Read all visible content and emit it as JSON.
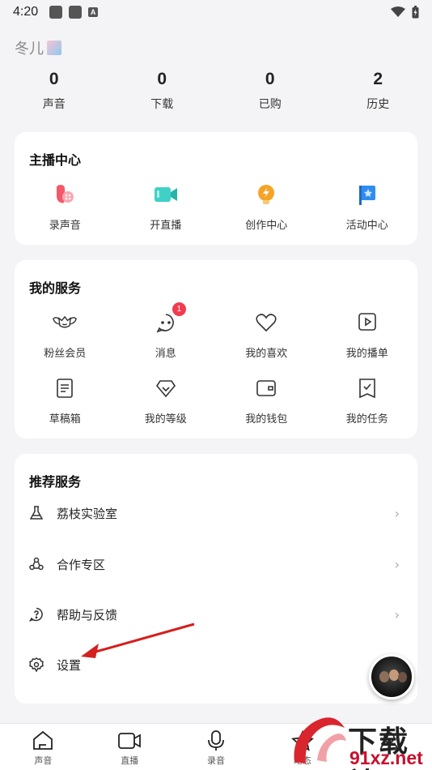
{
  "status": {
    "time": "4:20"
  },
  "profile": {
    "name": "冬儿"
  },
  "stats": [
    {
      "value": "0",
      "label": "声音"
    },
    {
      "value": "0",
      "label": "下载"
    },
    {
      "value": "0",
      "label": "已购"
    },
    {
      "value": "2",
      "label": "历史"
    }
  ],
  "anchor": {
    "title": "主播中心",
    "items": [
      {
        "label": "录声音",
        "icon": "record-voice-icon"
      },
      {
        "label": "开直播",
        "icon": "live-camera-icon"
      },
      {
        "label": "创作中心",
        "icon": "bulb-icon"
      },
      {
        "label": "活动中心",
        "icon": "flag-icon"
      }
    ]
  },
  "services": {
    "title": "我的服务",
    "items": [
      {
        "label": "粉丝会员",
        "icon": "crown-wings-icon"
      },
      {
        "label": "消息",
        "icon": "message-icon",
        "badge": "1"
      },
      {
        "label": "我的喜欢",
        "icon": "heart-icon"
      },
      {
        "label": "我的播单",
        "icon": "playlist-icon"
      },
      {
        "label": "草稿箱",
        "icon": "draft-icon"
      },
      {
        "label": "我的等级",
        "icon": "diamond-icon"
      },
      {
        "label": "我的钱包",
        "icon": "wallet-icon"
      },
      {
        "label": "我的任务",
        "icon": "task-icon"
      }
    ]
  },
  "recommend": {
    "title": "推荐服务",
    "items": [
      {
        "label": "荔枝实验室",
        "icon": "flask-icon",
        "chevron": "›"
      },
      {
        "label": "合作专区",
        "icon": "cooperation-icon",
        "chevron": "›"
      },
      {
        "label": "帮助与反馈",
        "icon": "help-icon",
        "chevron": "›"
      },
      {
        "label": "设置",
        "icon": "settings-icon"
      }
    ]
  },
  "nav": [
    {
      "label": "声音",
      "icon": "home-icon"
    },
    {
      "label": "直播",
      "icon": "video-icon"
    },
    {
      "label": "录音",
      "icon": "microphone-icon"
    },
    {
      "label": "动态",
      "icon": "star-icon"
    },
    {
      "label": "",
      "icon": "profile-icon"
    }
  ],
  "watermark": {
    "line1": "下载站",
    "line2": "91xz.net"
  },
  "colors": {
    "accent_red": "#f23b4e",
    "arrow_red": "#d42020"
  }
}
